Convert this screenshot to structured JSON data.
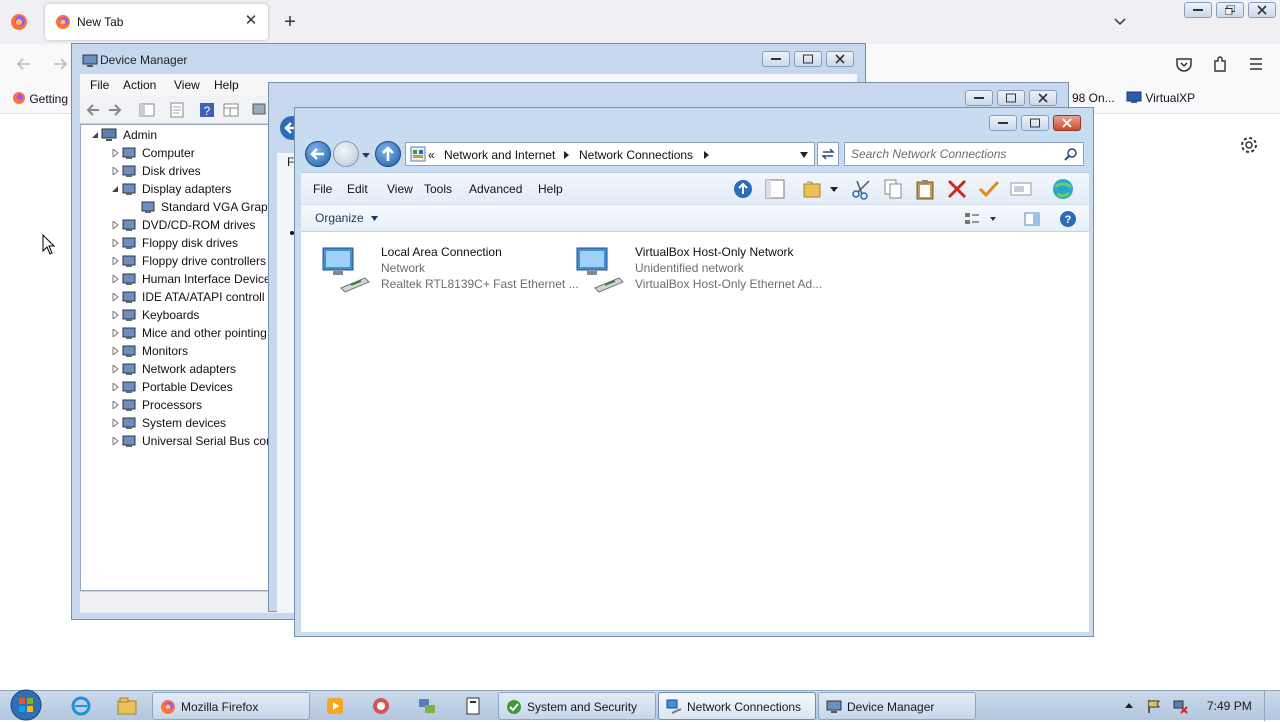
{
  "firefox": {
    "tab_title": "New Tab",
    "bookmarks": {
      "getting": "Getting",
      "item98": "98 On...",
      "virtualxp": "VirtualXP"
    }
  },
  "device_manager": {
    "title": "Device Manager",
    "menu": [
      "File",
      "Action",
      "View",
      "Help"
    ],
    "tree_root": "Admin",
    "tree": [
      {
        "label": "Computer",
        "expanded": false,
        "icon": "computer-icon"
      },
      {
        "label": "Disk drives",
        "expanded": false,
        "icon": "disk-drive-icon"
      },
      {
        "label": "Display adapters",
        "expanded": true,
        "icon": "display-adapter-icon"
      },
      {
        "label": "Standard VGA Graph",
        "child": true,
        "icon": "display-adapter-icon"
      },
      {
        "label": "DVD/CD-ROM drives",
        "expanded": false,
        "icon": "dvd-drive-icon"
      },
      {
        "label": "Floppy disk drives",
        "expanded": false,
        "icon": "floppy-icon"
      },
      {
        "label": "Floppy drive controllers",
        "expanded": false,
        "icon": "controller-icon"
      },
      {
        "label": "Human Interface Device",
        "expanded": false,
        "icon": "hid-icon"
      },
      {
        "label": "IDE ATA/ATAPI controll",
        "expanded": false,
        "icon": "ide-icon"
      },
      {
        "label": "Keyboards",
        "expanded": false,
        "icon": "keyboard-icon"
      },
      {
        "label": "Mice and other pointing",
        "expanded": false,
        "icon": "mouse-icon"
      },
      {
        "label": "Monitors",
        "expanded": false,
        "icon": "monitor-icon"
      },
      {
        "label": "Network adapters",
        "expanded": false,
        "icon": "network-adapter-icon"
      },
      {
        "label": "Portable Devices",
        "expanded": false,
        "icon": "portable-device-icon"
      },
      {
        "label": "Processors",
        "expanded": false,
        "icon": "processor-icon"
      },
      {
        "label": "System devices",
        "expanded": false,
        "icon": "system-device-icon"
      },
      {
        "label": "Universal Serial Bus cont",
        "expanded": false,
        "icon": "usb-icon"
      }
    ]
  },
  "middle_window": {
    "menu_fragment": "Fi"
  },
  "network_connections": {
    "breadcrumb_prefix": "«",
    "breadcrumb": [
      "Network and Internet",
      "Network Connections"
    ],
    "search_placeholder": "Search Network Connections",
    "menu": [
      "File",
      "Edit",
      "View",
      "Tools",
      "Advanced",
      "Help"
    ],
    "organize_label": "Organize",
    "connections": [
      {
        "name": "Local Area Connection",
        "status": "Network",
        "device": "Realtek RTL8139C+ Fast Ethernet ..."
      },
      {
        "name": "VirtualBox Host-Only Network",
        "status": "Unidentified network",
        "device": "VirtualBox Host-Only Ethernet Ad..."
      }
    ]
  },
  "taskbar": {
    "buttons": [
      {
        "label": "Mozilla Firefox",
        "icon": "firefox-icon"
      },
      {
        "label": "System and Security",
        "icon": "control-panel-icon"
      },
      {
        "label": "Network Connections",
        "icon": "network-connections-icon"
      },
      {
        "label": "Device Manager",
        "icon": "device-manager-icon"
      }
    ],
    "clock": "7:49 PM"
  },
  "colors": {
    "win_frame": "#c7d8ee",
    "taskbar": "#b3c7df",
    "accent_blue": "#1f5fa8",
    "close_red": "#c74a2f"
  }
}
